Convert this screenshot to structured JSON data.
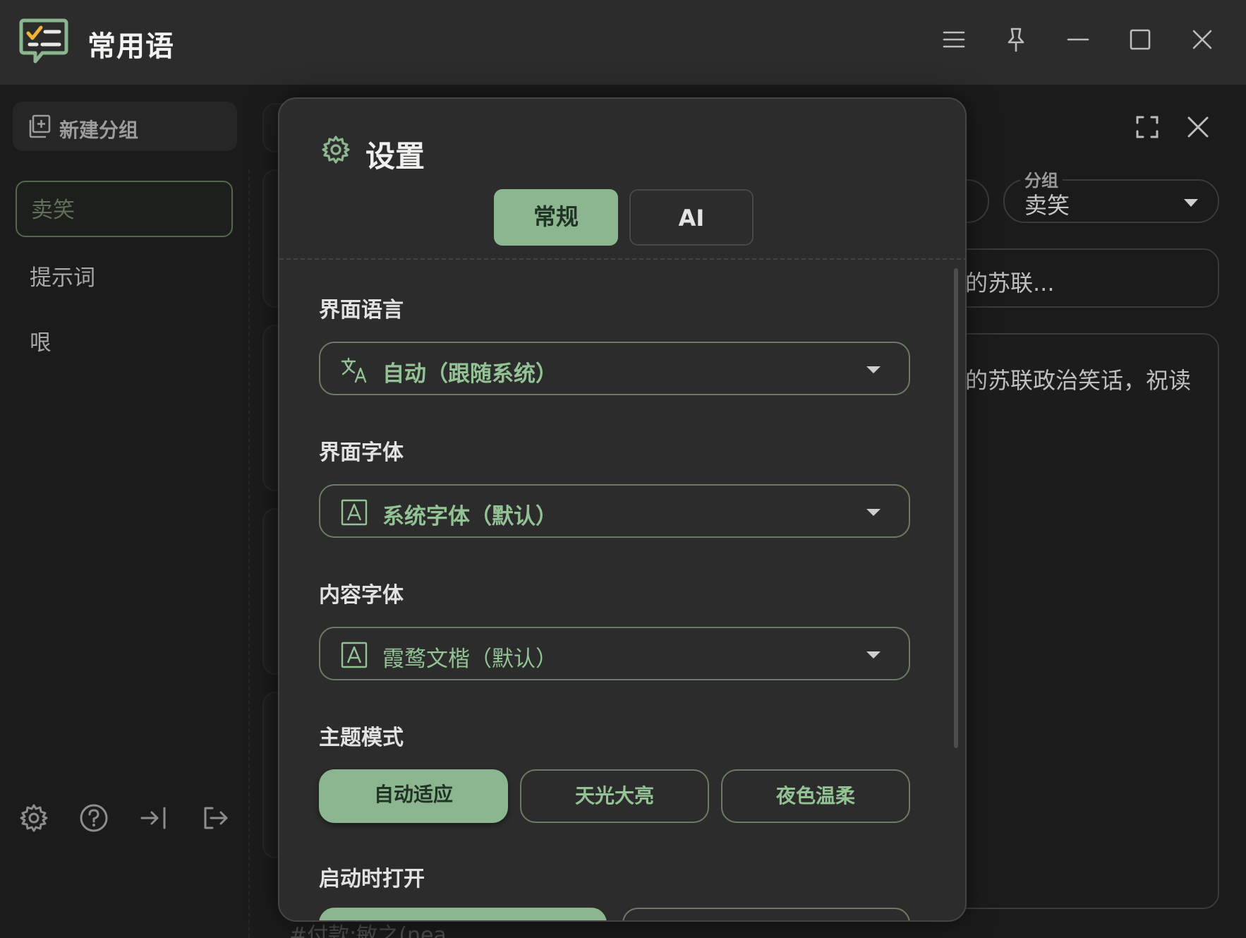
{
  "app": {
    "title": "常用语",
    "logo_icon": "checklist-chat-icon",
    "accent_color": "#8cb68f"
  },
  "window_controls": [
    "menu-icon",
    "pin-icon",
    "minimize-icon",
    "maximize-icon",
    "close-icon"
  ],
  "sidebar": {
    "new_group_label": "新建分组",
    "groups": [
      {
        "label": "卖笑",
        "active": true
      },
      {
        "label": "提示词",
        "active": false
      },
      {
        "label": "哏",
        "active": false
      }
    ],
    "footer_icons": [
      "settings-icon",
      "help-icon",
      "import-icon",
      "export-icon"
    ]
  },
  "background_list": {
    "snippet": "#付款:敏之(nea"
  },
  "editor": {
    "group_label": "分组",
    "group_value": "卖笑",
    "title_fragment": "的苏联...",
    "content_fragment": "的苏联政治笑话，祝读"
  },
  "settings": {
    "title": "设置",
    "tabs": [
      {
        "label": "常规",
        "active": true
      },
      {
        "label": "AI",
        "active": false
      }
    ],
    "fields": {
      "ui_language": {
        "label": "界面语言",
        "value": "自动（跟随系统）",
        "icon": "translate-icon"
      },
      "ui_font": {
        "label": "界面字体",
        "value": "系统字体（默认）",
        "icon": "font-icon"
      },
      "content_font": {
        "label": "内容字体",
        "value": "霞鹜文楷（默认）",
        "icon": "font-icon"
      }
    },
    "theme": {
      "label": "主题模式",
      "options": [
        "自动适应",
        "天光大亮",
        "夜色温柔"
      ],
      "selected": "自动适应"
    },
    "startup": {
      "label": "启动时打开"
    }
  }
}
